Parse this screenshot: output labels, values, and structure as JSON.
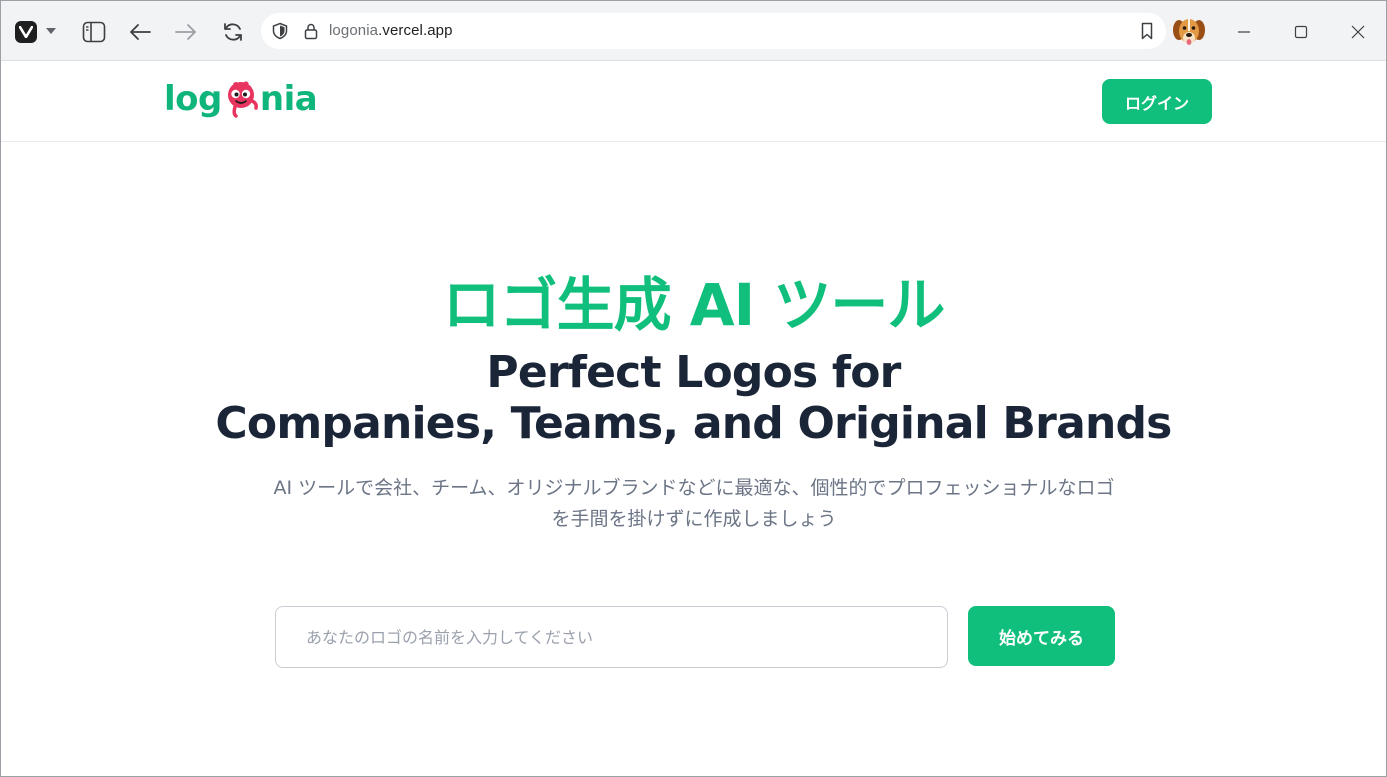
{
  "browser": {
    "url_domain_prefix": "logonia",
    "url_domain_suffix": ".vercel.app"
  },
  "icons": {
    "vivaldi": "vivaldi-logo-icon",
    "menu_caret": "chevron-down-icon",
    "panel": "panel-toggle-icon",
    "back": "arrow-left-icon",
    "forward": "arrow-right-icon",
    "reload": "reload-icon",
    "shield": "shield-icon",
    "lock": "lock-icon",
    "bookmark": "bookmark-icon",
    "profile": "dog-avatar-icon",
    "minimize": "minimize-icon",
    "maximize": "maximize-icon",
    "close": "close-icon"
  },
  "site": {
    "logo_text_left": "log",
    "logo_text_right": "nia",
    "login_label": "ログイン"
  },
  "hero": {
    "title_ja": "ロゴ生成 AI ツール",
    "title_en_line1": "Perfect Logos for",
    "title_en_line2": "Companies, Teams, and Original Brands",
    "subtitle_line1": "AI ツールで会社、チーム、オリジナルブランドなどに最適な、個性的でプロフェッショナルなロゴ",
    "subtitle_line2": "を手間を掛けずに作成しましょう",
    "input_placeholder": "あなたのロゴの名前を入力してください",
    "input_value": "",
    "start_label": "始めてみる"
  },
  "colors": {
    "brand_green": "#10bf7c",
    "heading_navy": "#1b2538",
    "subtext_gray": "#6b7586",
    "mascot_pink": "#e8355f"
  }
}
